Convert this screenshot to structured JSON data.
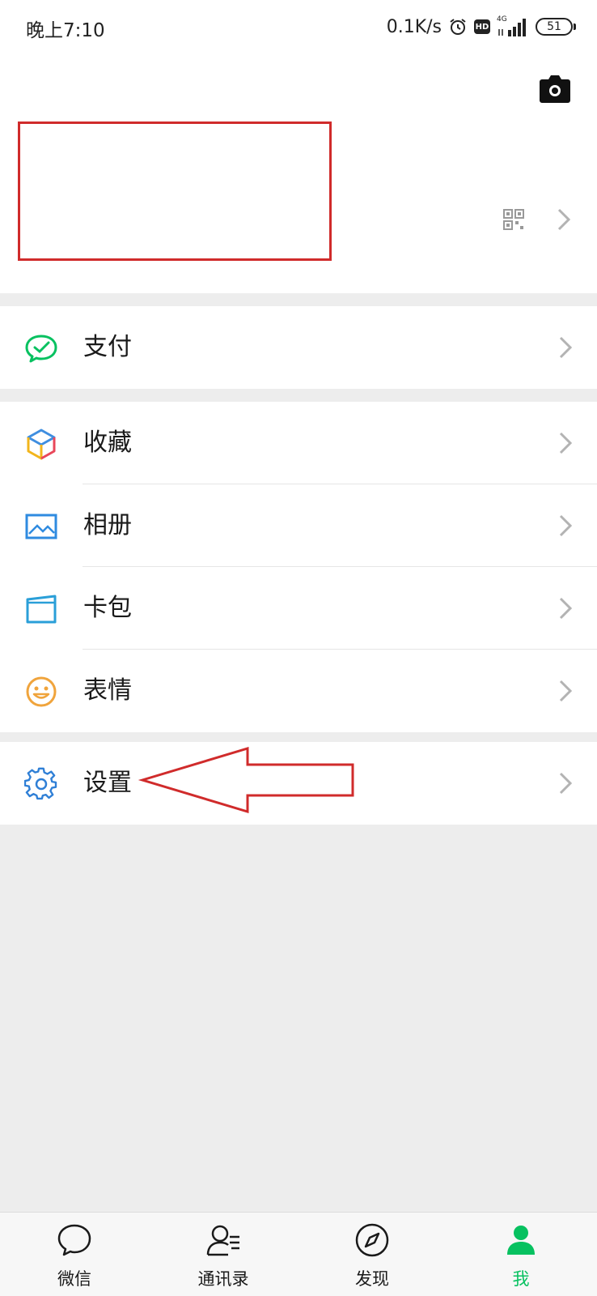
{
  "status_bar": {
    "time": "晚上7:10",
    "speed": "0.1K/s",
    "hd": "HD",
    "network": "4G",
    "battery": "51"
  },
  "menu": {
    "pay": "支付",
    "favorites": "收藏",
    "album": "相册",
    "cards": "卡包",
    "stickers": "表情",
    "settings": "设置"
  },
  "tabs": {
    "chats": "微信",
    "contacts": "通讯录",
    "discover": "发现",
    "me": "我"
  },
  "colors": {
    "accent": "#07c160",
    "annotation": "#d02b2b"
  }
}
